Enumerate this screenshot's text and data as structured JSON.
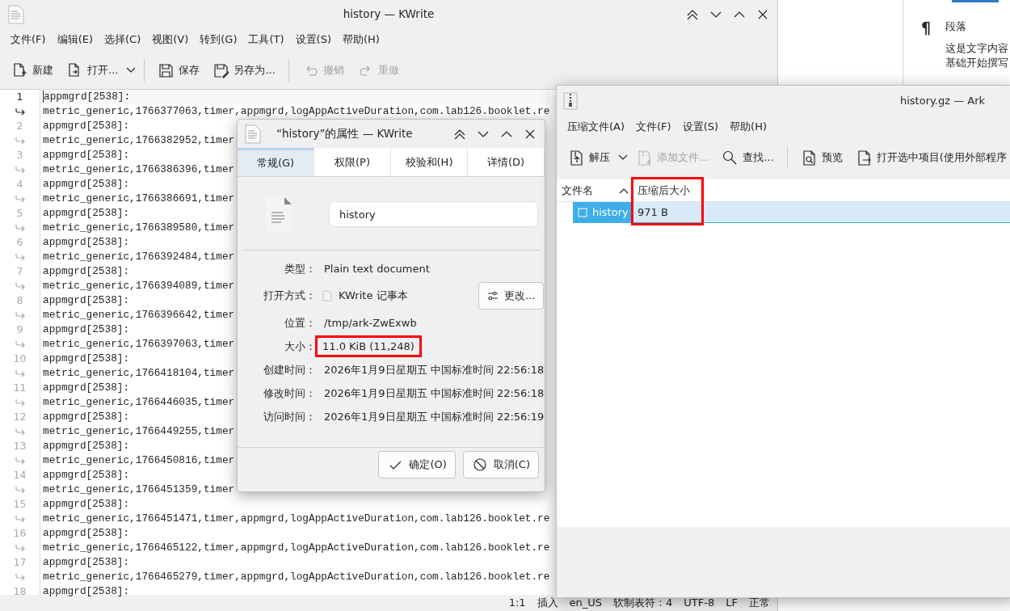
{
  "kwrite": {
    "title": "history — KWrite",
    "menu": [
      "文件(F)",
      "编辑(E)",
      "选择(C)",
      "视图(V)",
      "转到(G)",
      "工具(T)",
      "设置(S)",
      "帮助(H)"
    ],
    "toolbar": [
      {
        "label": "新建",
        "kind": "new",
        "disabled": false,
        "dropdown": false,
        "separator_after": false
      },
      {
        "label": "打开...",
        "kind": "open",
        "disabled": false,
        "dropdown": true,
        "separator_after": true
      },
      {
        "label": "保存",
        "kind": "save",
        "disabled": false,
        "dropdown": false,
        "separator_after": false
      },
      {
        "label": "另存为...",
        "kind": "saveas",
        "disabled": false,
        "dropdown": false,
        "separator_after": true
      },
      {
        "label": "撤销",
        "kind": "undo",
        "disabled": true,
        "dropdown": false,
        "separator_after": false
      },
      {
        "label": "重做",
        "kind": "redo",
        "disabled": true,
        "dropdown": false,
        "separator_after": false
      }
    ],
    "lines": [
      {
        "number": "1",
        "current": true,
        "text": "appmgrd[2538]:",
        "continuation": "metric_generic,1766377063,timer,appmgrd,logAppActiveDuration,com.lab126.booklet.re"
      },
      {
        "number": "2",
        "current": false,
        "text": "appmgrd[2538]:",
        "continuation": "metric_generic,1766382952,timer"
      },
      {
        "number": "3",
        "current": false,
        "text": "appmgrd[2538]:",
        "continuation": "metric_generic,1766386396,timer"
      },
      {
        "number": "4",
        "current": false,
        "text": "appmgrd[2538]:",
        "continuation": "metric_generic,1766386691,timer"
      },
      {
        "number": "5",
        "current": false,
        "text": "appmgrd[2538]:",
        "continuation": "metric_generic,1766389580,timer"
      },
      {
        "number": "6",
        "current": false,
        "text": "appmgrd[2538]:",
        "continuation": "metric_generic,1766392484,timer"
      },
      {
        "number": "7",
        "current": false,
        "text": "appmgrd[2538]:",
        "continuation": "metric_generic,1766394089,timer"
      },
      {
        "number": "8",
        "current": false,
        "text": "appmgrd[2538]:",
        "continuation": "metric_generic,1766396642,timer"
      },
      {
        "number": "9",
        "current": false,
        "text": "appmgrd[2538]:",
        "continuation": "metric_generic,1766397063,timer"
      },
      {
        "number": "10",
        "current": false,
        "text": "appmgrd[2538]:",
        "continuation": "metric_generic,1766418104,timer"
      },
      {
        "number": "11",
        "current": false,
        "text": "appmgrd[2538]:",
        "continuation": "metric_generic,1766446035,timer"
      },
      {
        "number": "12",
        "current": false,
        "text": "appmgrd[2538]:",
        "continuation": "metric_generic,1766449255,timer"
      },
      {
        "number": "13",
        "current": false,
        "text": "appmgrd[2538]:",
        "continuation": "metric_generic,1766450816,timer"
      },
      {
        "number": "14",
        "current": false,
        "text": "appmgrd[2538]:",
        "continuation": "metric_generic,1766451359,timer"
      },
      {
        "number": "15",
        "current": false,
        "text": "appmgrd[2538]:",
        "continuation": "metric_generic,1766451471,timer,appmgrd,logAppActiveDuration,com.lab126.booklet.re"
      },
      {
        "number": "16",
        "current": false,
        "text": "appmgrd[2538]:",
        "continuation": "metric_generic,1766465122,timer,appmgrd,logAppActiveDuration,com.lab126.booklet.re"
      },
      {
        "number": "17",
        "current": false,
        "text": "appmgrd[2538]:",
        "continuation": "metric_generic,1766465279,timer,appmgrd,logAppActiveDuration,com.lab126.booklet.re"
      },
      {
        "number": "18",
        "current": false,
        "text": "appmgrd[2538]:"
      }
    ],
    "status_bar": [
      "1:1",
      "插入",
      "en_US",
      "软制表符：4",
      "UTF-8",
      "LF",
      "正常"
    ]
  },
  "side_panel": {
    "symbol": "¶",
    "heading": "段落",
    "lines": [
      "这是文字内容",
      "基础开始撰写"
    ]
  },
  "properties_dialog": {
    "title": "“history”的属性 — KWrite",
    "tabs": [
      {
        "label": "常规(G)",
        "selected": true
      },
      {
        "label": "权限(P)",
        "selected": false
      },
      {
        "label": "校验和(H)",
        "selected": false
      },
      {
        "label": "详情(D)",
        "selected": false
      }
    ],
    "name": "history",
    "fields": [
      {
        "label": "类型：",
        "value": "Plain text document",
        "highlighted": false
      },
      {
        "label": "打开方式：",
        "value": "KWrite 记事本",
        "app_icon": true,
        "button": "更改...",
        "highlighted": false
      },
      {
        "label": "位置：",
        "value": "/tmp/ark-ZwExwb",
        "highlighted": false
      },
      {
        "label": "大小：",
        "value": "11.0 KiB (11,248)",
        "highlighted": true
      },
      {
        "label": "创建时间：",
        "value": "2026年1月9日星期五 中国标准时间 22:56:18",
        "highlighted": false
      },
      {
        "label": "修改时间：",
        "value": "2026年1月9日星期五 中国标准时间 22:56:18",
        "highlighted": false
      },
      {
        "label": "访问时间：",
        "value": "2026年1月9日星期五 中国标准时间 22:56:19",
        "highlighted": false
      }
    ],
    "buttons": [
      {
        "label": "确定(O)",
        "kind": "ok"
      },
      {
        "label": "取消(C)",
        "kind": "cancel"
      }
    ]
  },
  "ark": {
    "title": "history.gz — Ark",
    "menu": [
      "压缩文件(A)",
      "文件(F)",
      "设置(S)",
      "帮助(H)"
    ],
    "toolbar": [
      {
        "label": "解压",
        "kind": "extract",
        "disabled": false,
        "dropdown": true,
        "separator_after": false
      },
      {
        "label": "添加文件...",
        "kind": "add",
        "disabled": true,
        "dropdown": false,
        "separator_after": false
      },
      {
        "label": "查找...",
        "kind": "find",
        "disabled": false,
        "dropdown": false,
        "separator_after": true
      },
      {
        "label": "预览",
        "kind": "preview",
        "disabled": false,
        "dropdown": false,
        "separator_after": false
      },
      {
        "label": "打开选中项目(使用外部程序",
        "kind": "openext",
        "disabled": false,
        "dropdown": false,
        "separator_after": false
      }
    ],
    "columns": [
      {
        "label": "文件名",
        "sorted": true,
        "highlighted": false
      },
      {
        "label": "压缩后大小",
        "sorted": false,
        "highlighted": true
      }
    ],
    "rows": [
      {
        "cells": [
          "history",
          "971 B"
        ],
        "selected": true
      }
    ]
  }
}
